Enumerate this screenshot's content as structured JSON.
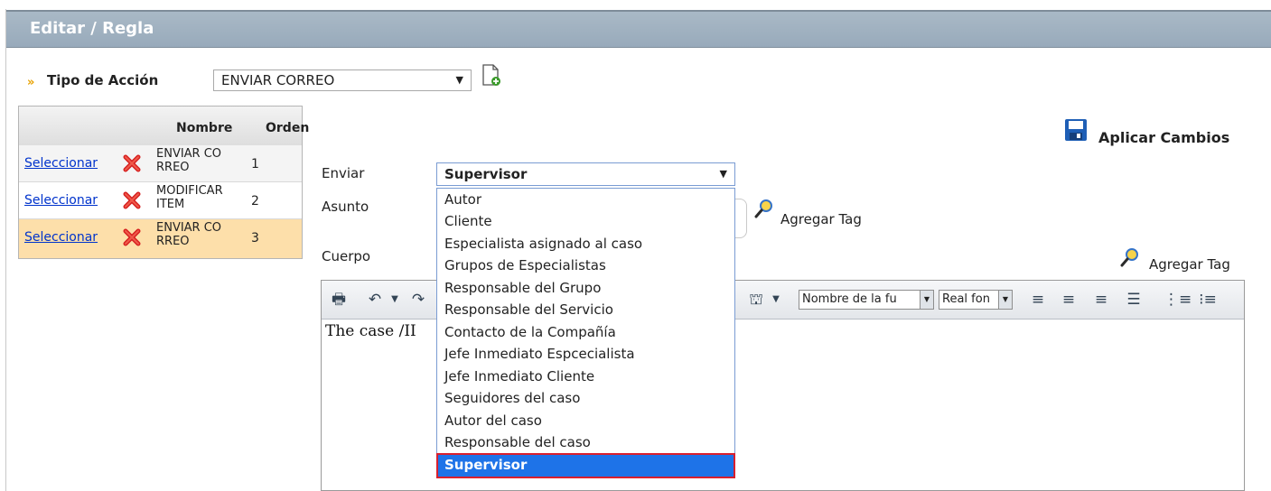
{
  "window": {
    "title": "Editar / Regla"
  },
  "tipo_accion": {
    "label": "Tipo de Acción",
    "value": "ENVIAR CORREO"
  },
  "grid": {
    "columns": [
      "Nombre",
      "Orden"
    ],
    "rows": [
      {
        "link": "Seleccionar",
        "nombre": "ENVIAR CORREO",
        "orden": "1"
      },
      {
        "link": "Seleccionar",
        "nombre": "MODIFICAR ITEM",
        "orden": "2"
      },
      {
        "link": "Seleccionar",
        "nombre": "ENVIAR CORREO",
        "orden": "3"
      }
    ]
  },
  "apply": {
    "label": "Aplicar Cambios"
  },
  "form": {
    "enviar_label": "Enviar",
    "enviar_value": "Supervisor",
    "asunto_label": "Asunto",
    "cuerpo_label": "Cuerpo",
    "agregar_tag": "Agregar Tag"
  },
  "dropdown": {
    "options": [
      "Autor",
      "Cliente",
      "Especialista asignado al caso",
      "Grupos de Especialistas",
      "Responsable del Grupo",
      "Responsable del Servicio",
      "Contacto de la Compañía",
      "Jefe Inmediato Espcecialista",
      "Jefe Inmediato Cliente",
      "Seguidores del caso",
      "Autor del caso",
      "Responsable del caso",
      "Supervisor"
    ],
    "selected": "Supervisor"
  },
  "editor": {
    "font_name": "Nombre de la fu",
    "font_size": "Real fon",
    "body_text": "The case  /II"
  },
  "colors": {
    "titlebar": "#9fb0c0",
    "selected_row": "#fddfaa",
    "highlight": "#1e73e8",
    "highlight_border": "#d9202e"
  }
}
